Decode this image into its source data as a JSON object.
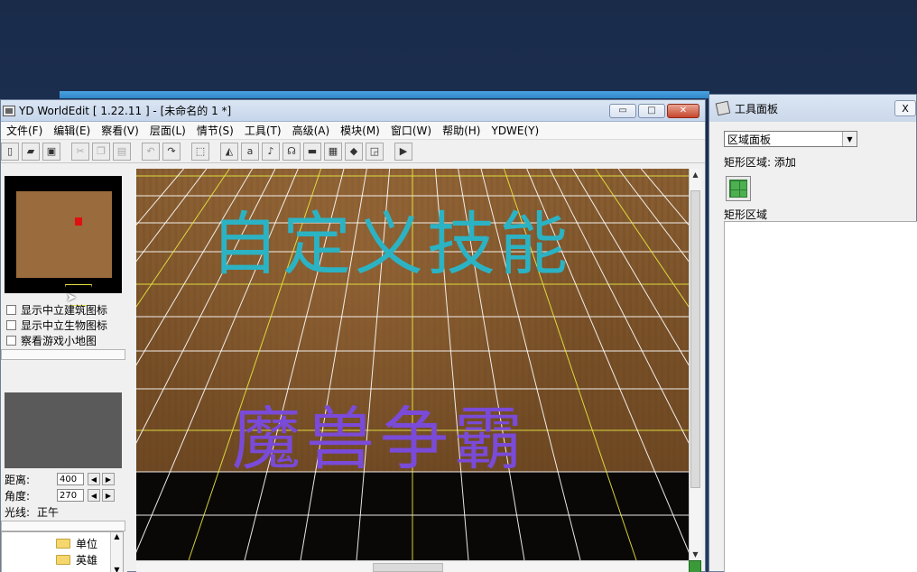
{
  "editor": {
    "title": "YD WorldEdit [ 1.22.11 ] - [未命名的 1 *]",
    "window_buttons": {
      "minimize": "▭",
      "maximize": "□",
      "close": "✕"
    },
    "menu": [
      "文件(F)",
      "编辑(E)",
      "察看(V)",
      "层面(L)",
      "情节(S)",
      "工具(T)",
      "高级(A)",
      "模块(M)",
      "窗口(W)",
      "帮助(H)",
      "YDWE(Y)"
    ]
  },
  "left_panel": {
    "checkboxes": [
      "显示中立建筑图标",
      "显示中立生物图标",
      "察看游戏小地图"
    ],
    "properties": {
      "distance_label": "距离:",
      "distance_value": "400",
      "angle_label": "角度:",
      "angle_value": "270",
      "light_label": "光线:",
      "light_value": "正午"
    },
    "tree": [
      "单位",
      "英雄"
    ]
  },
  "viewport": {
    "overlay_title": "自定义技能",
    "overlay_subtitle": "魔兽争霸"
  },
  "tool_panel": {
    "title": "工具面板",
    "close": "X",
    "palette_select": "区域面板",
    "rect_region_add": "矩形区域: 添加",
    "rect_region_header": "矩形区域"
  },
  "colors": {
    "overlay_title": "#2bb3c4",
    "overlay_subtitle": "#7a4ad8",
    "grid_yellow": "#e8e840",
    "grid_white": "#ffffff",
    "minimap_unit": "#e01010"
  }
}
